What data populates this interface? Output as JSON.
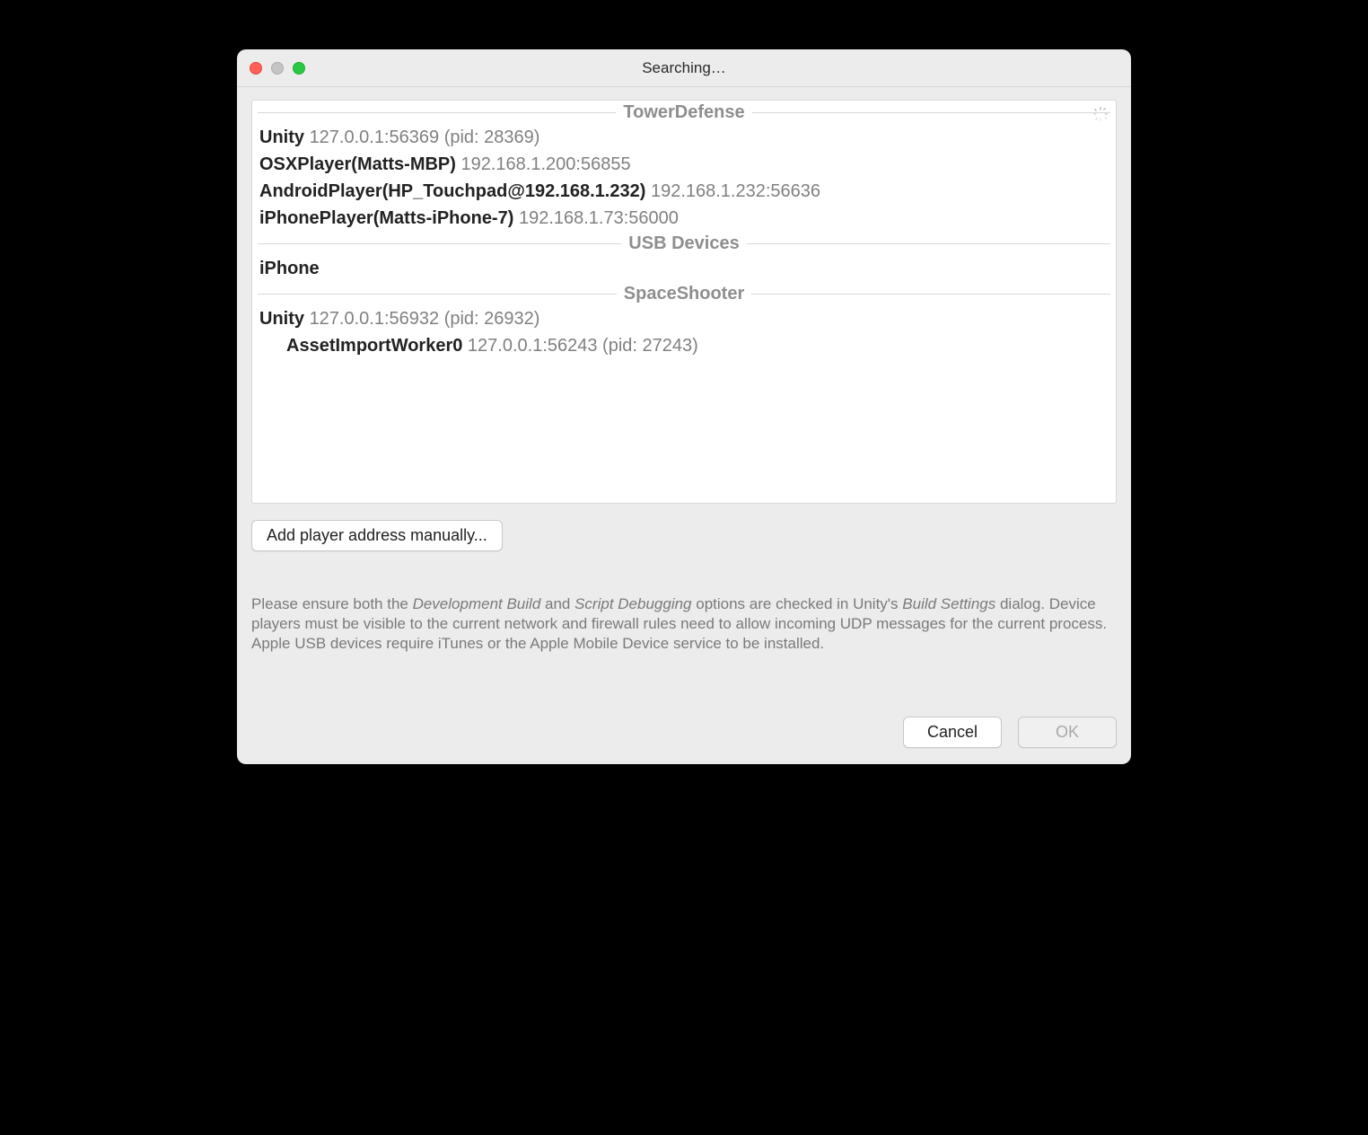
{
  "window": {
    "title": "Searching…"
  },
  "groups": [
    {
      "label": "TowerDefense",
      "rows": [
        {
          "name": "Unity",
          "addr": "127.0.0.1:56369 (pid: 28369)",
          "indent": false
        },
        {
          "name": "OSXPlayer(Matts-MBP)",
          "addr": "192.168.1.200:56855",
          "indent": false
        },
        {
          "name": "AndroidPlayer(HP_Touchpad@192.168.1.232)",
          "addr": "192.168.1.232:56636",
          "indent": false
        },
        {
          "name": "iPhonePlayer(Matts-iPhone-7)",
          "addr": "192.168.1.73:56000",
          "indent": false
        }
      ]
    },
    {
      "label": "USB Devices",
      "rows": [
        {
          "name": "iPhone",
          "addr": "",
          "indent": false
        }
      ]
    },
    {
      "label": "SpaceShooter",
      "rows": [
        {
          "name": "Unity",
          "addr": "127.0.0.1:56932 (pid: 26932)",
          "indent": false
        },
        {
          "name": "AssetImportWorker0",
          "addr": "127.0.0.1:56243 (pid: 27243)",
          "indent": true
        }
      ]
    }
  ],
  "buttons": {
    "addManual": "Add player address manually...",
    "cancel": "Cancel",
    "ok": "OK"
  },
  "help": {
    "t1": "Please ensure both the ",
    "i1": "Development Build",
    "t2": " and ",
    "i2": "Script Debugging",
    "t3": " options are checked in Unity's ",
    "i3": "Build Settings",
    "t4": " dialog. Device players must be visible to the current network and firewall rules need to allow incoming UDP messages for the current process. Apple USB devices require iTunes or the Apple Mobile Device service to be installed."
  }
}
